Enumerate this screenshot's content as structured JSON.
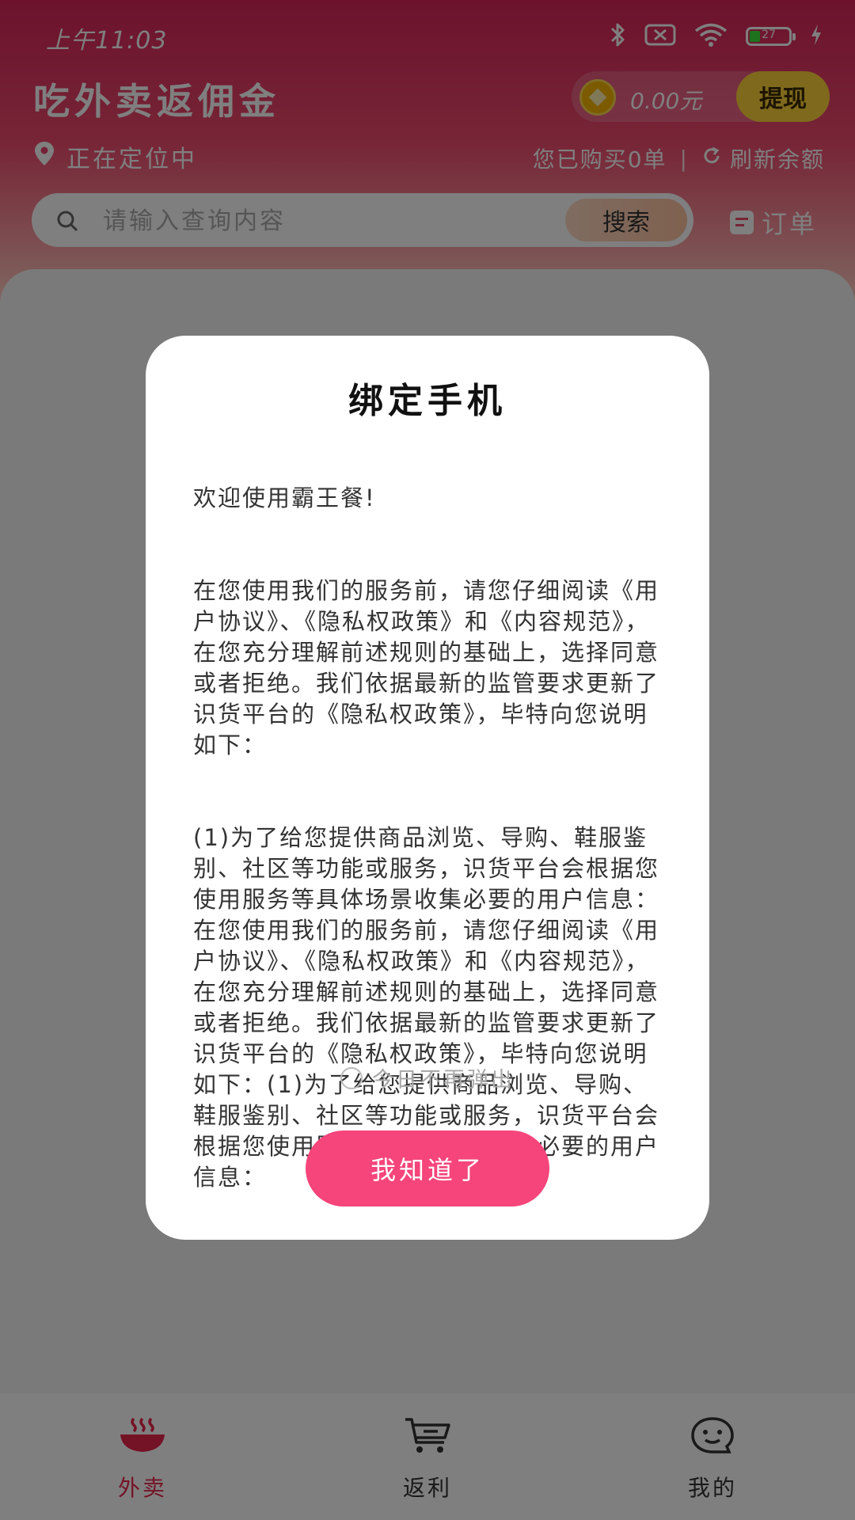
{
  "status_bar": {
    "time": "上午11:03",
    "battery_level": "27",
    "icons": [
      "bluetooth-icon",
      "sim-card-icon",
      "wifi-icon",
      "battery-icon",
      "charging-icon"
    ]
  },
  "header": {
    "title": "吃外卖返佣金",
    "balance": "0.00元",
    "withdraw_label": "提现",
    "location_text": "正在定位中",
    "purchased_text": "您已购买0单",
    "refresh_label": "刷新余额"
  },
  "search": {
    "placeholder": "请输入查询内容",
    "button_label": "搜索",
    "orders_label": "订单"
  },
  "dialog": {
    "title": "绑定手机",
    "paragraphs": [
      "欢迎使用霸王餐!",
      "在您使用我们的服务前，请您仔细阅读《用户协议》、《隐私权政策》和《内容规范》，在您充分理解前述规则的基础上，选择同意或者拒绝。我们依据最新的监管要求更新了识货平台的《隐私权政策》，毕特向您说明如下：",
      "(1)为了给您提供商品浏览、导购、鞋服鉴别、社区等功能或服务，识货平台会根据您使用服务等具体场景收集必要的用户信息：在您使用我们的服务前，请您仔细阅读《用户协议》、《隐私权政策》和《内容规范》，在您充分理解前述规则的基础上，选择同意或者拒绝。我们依据最新的监管要求更新了识货平台的《隐私权政策》，毕特向您说明如下：(1)为了给您提供商品浏览、导购、鞋服鉴别、社区等功能或服务，识货平台会根据您使用服务等具体场景收集必要的用户信息："
    ],
    "dont_show_label": "今日不再弹出",
    "ack_button_label": "我知道了"
  },
  "bottom_nav": {
    "items": [
      {
        "label": "外卖",
        "icon": "food-bowl-icon",
        "active": true
      },
      {
        "label": "返利",
        "icon": "cart-icon",
        "active": false
      },
      {
        "label": "我的",
        "icon": "profile-face-icon",
        "active": false
      }
    ]
  },
  "colors": {
    "brand_red": "#e8244c",
    "button_pink": "#f5457a",
    "withdraw_yellow": "#ffd23a"
  }
}
